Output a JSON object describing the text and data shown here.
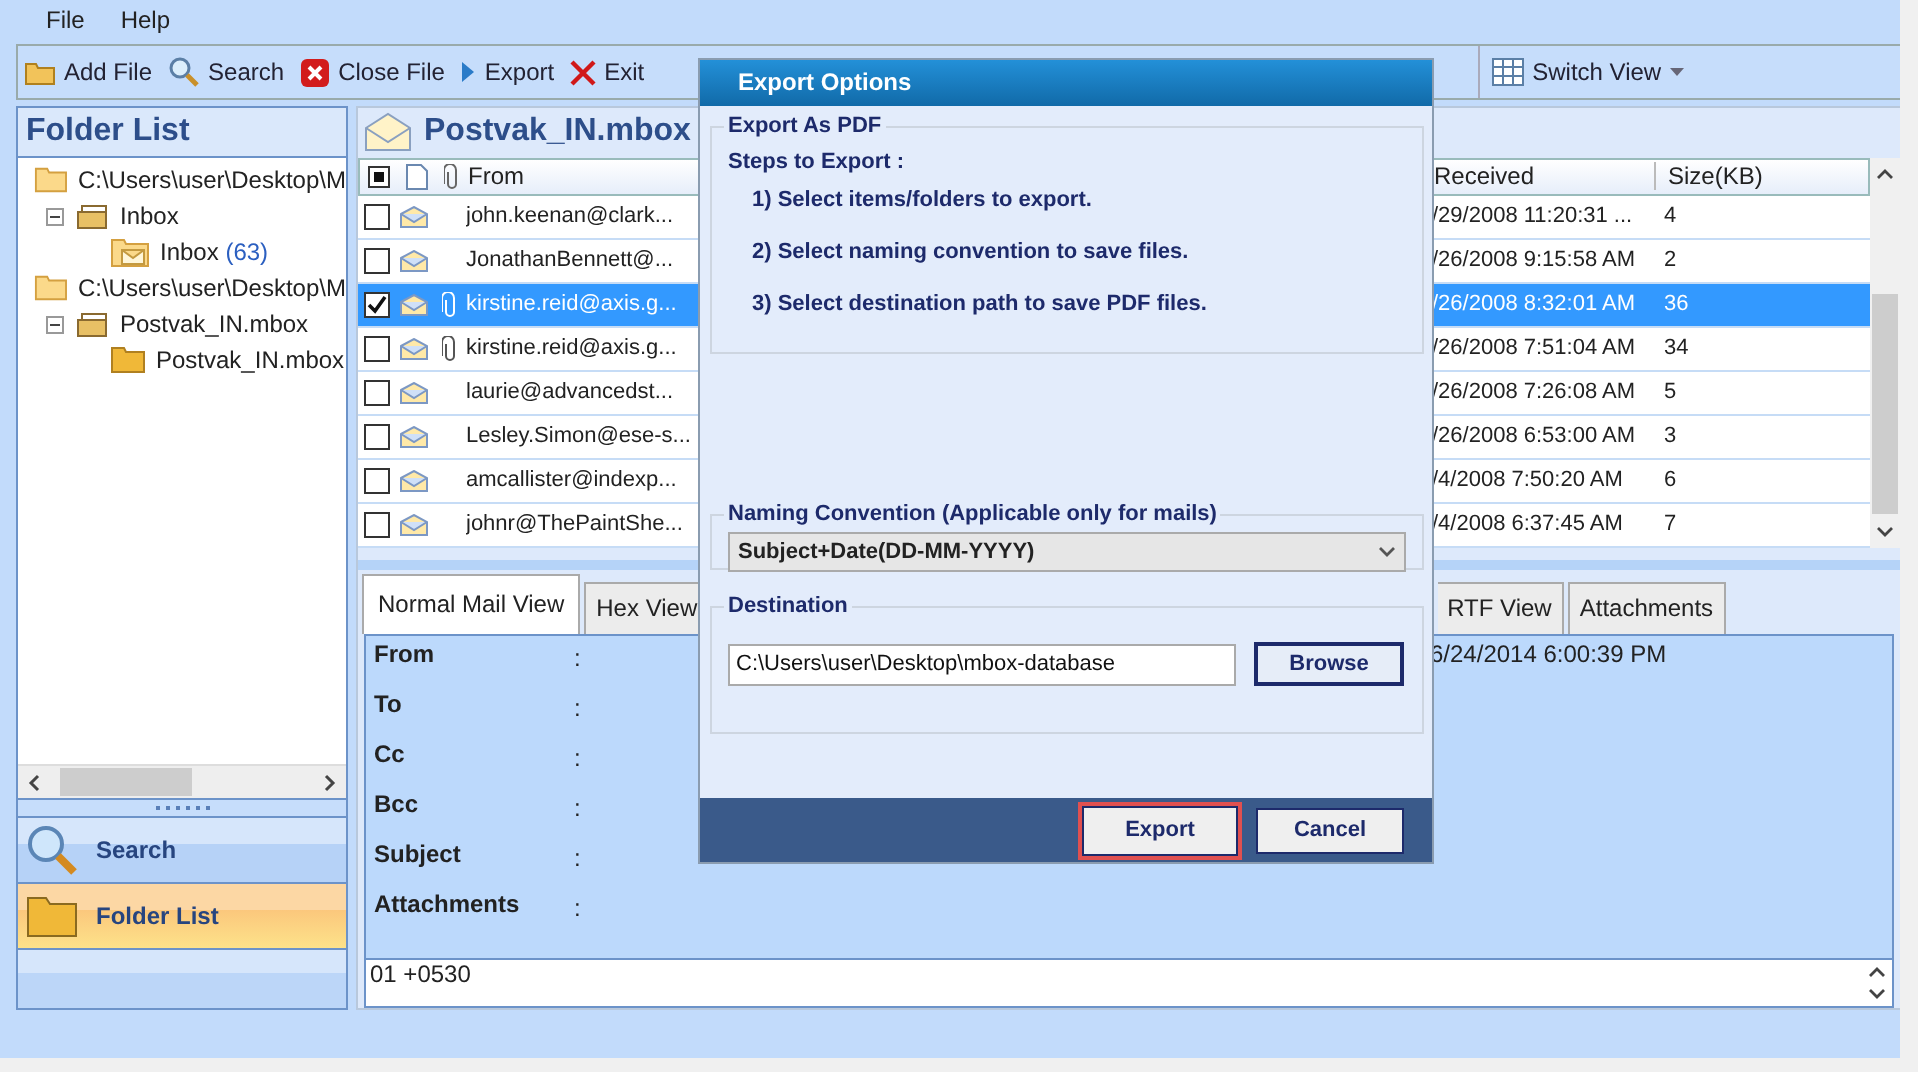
{
  "menu": [
    "File",
    "Help"
  ],
  "toolbar": [
    "Add File",
    "Search",
    "Close File",
    "Export",
    "Exit"
  ],
  "switch_view": "Switch View",
  "folder_list": {
    "title": "Folder List",
    "tree": [
      {
        "label": "C:\\Users\\user\\Desktop\\M",
        "children": [
          {
            "label": "Inbox",
            "expanded": true,
            "children": [
              {
                "label": "Inbox",
                "count": "(63)",
                "kind": "mail"
              }
            ]
          }
        ]
      },
      {
        "label": "C:\\Users\\user\\Desktop\\M",
        "children": [
          {
            "label": "Postvak_IN.mbox",
            "expanded": true,
            "children": [
              {
                "label": "Postvak_IN.mbox",
                "kind": "plain"
              }
            ]
          }
        ]
      }
    ]
  },
  "nav": [
    {
      "label": "Search",
      "selected": false
    },
    {
      "label": "Folder List",
      "selected": true
    }
  ],
  "mailbox": {
    "title": "Postvak_IN.mbox",
    "select_all_partial": true,
    "columns": {
      "from": "From",
      "received": "Received",
      "size": "Size(KB)"
    },
    "rows": [
      {
        "checked": false,
        "selected": false,
        "attachment": false,
        "from": "john.keenan@clark...",
        "received": "/29/2008 11:20:31 ...",
        "size": "4"
      },
      {
        "checked": false,
        "selected": false,
        "attachment": false,
        "from": "JonathanBennett@...",
        "received": "/26/2008 9:15:58 AM",
        "size": "2"
      },
      {
        "checked": true,
        "selected": true,
        "attachment": true,
        "from": "kirstine.reid@axis.g...",
        "received": "/26/2008 8:32:01 AM",
        "size": "36"
      },
      {
        "checked": false,
        "selected": false,
        "attachment": true,
        "from": "kirstine.reid@axis.g...",
        "received": "/26/2008 7:51:04 AM",
        "size": "34"
      },
      {
        "checked": false,
        "selected": false,
        "attachment": false,
        "from": "laurie@advancedst...",
        "received": "/26/2008 7:26:08 AM",
        "size": "5"
      },
      {
        "checked": false,
        "selected": false,
        "attachment": false,
        "from": "Lesley.Simon@ese-s...",
        "received": "/26/2008 6:53:00 AM",
        "size": "3"
      },
      {
        "checked": false,
        "selected": false,
        "attachment": false,
        "from": "amcallister@indexp...",
        "received": "/4/2008 7:50:20 AM",
        "size": "6"
      },
      {
        "checked": false,
        "selected": false,
        "attachment": false,
        "from": "johnr@ThePaintShe...",
        "received": "/4/2008 6:37:45 AM",
        "size": "7"
      }
    ]
  },
  "tabs": [
    {
      "label": "Normal Mail View",
      "selected": true
    },
    {
      "label": "Hex View",
      "selected": false
    },
    {
      "label": "RTF View",
      "selected": false
    },
    {
      "label": "Attachments",
      "selected": false
    }
  ],
  "mail_fields": [
    {
      "label": "From",
      "separator": ":"
    },
    {
      "label": "To",
      "separator": ":"
    },
    {
      "label": "Cc",
      "separator": ":"
    },
    {
      "label": "Bcc",
      "separator": ":"
    },
    {
      "label": "Subject",
      "separator": ":"
    },
    {
      "label": "Attachments",
      "separator": ":"
    }
  ],
  "date_value": "6/24/2014 6:00:39 PM",
  "body": "01 +0530",
  "dialog": {
    "title": "Export Options",
    "group_title": "Export As PDF",
    "steps_title": "Steps to Export :",
    "steps": [
      "1) Select items/folders to export.",
      "2) Select naming convention to save files.",
      "3) Select destination path to save PDF files."
    ],
    "naming": {
      "title": "Naming Convention (Applicable only for mails)",
      "value": "Subject+Date(DD-MM-YYYY)"
    },
    "destination": {
      "title": "Destination",
      "value": "C:\\Users\\user\\Desktop\\mbox-database",
      "browse": "Browse"
    },
    "buttons": [
      {
        "label": "Export",
        "selected": true
      },
      {
        "label": "Cancel",
        "selected": false
      }
    ]
  }
}
